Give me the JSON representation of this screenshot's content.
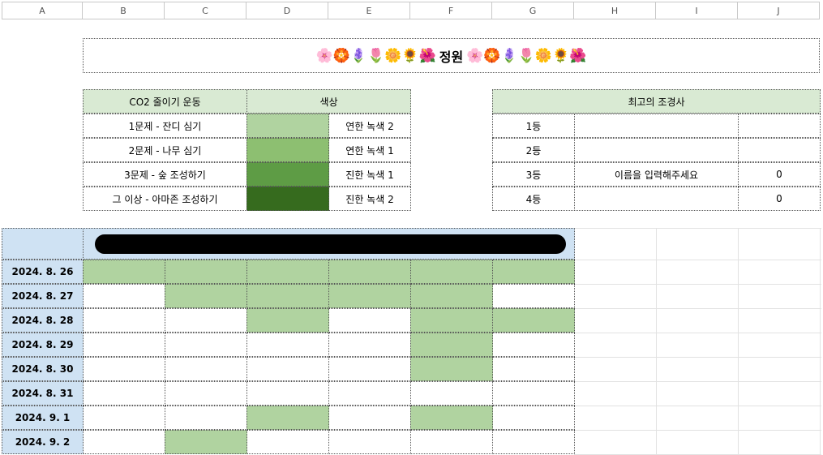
{
  "columns": [
    "A",
    "B",
    "C",
    "D",
    "E",
    "F",
    "G",
    "H",
    "I",
    "J"
  ],
  "title": {
    "emoji_left": "🌸🏵️🪻🌷🌼🌻🌺",
    "text": "정원",
    "emoji_right": "🌸🏵️🪻🌷🌼🌻🌺"
  },
  "legend": {
    "header_activity": "CO2 줄이기 운동",
    "header_color": "색상",
    "rows": [
      {
        "activity": "1문제 - 잔디 심기",
        "swatch": "#b0d3a0",
        "color_name": "연한 녹색 2"
      },
      {
        "activity": "2문제 - 나무 심기",
        "swatch": "#8dbf71",
        "color_name": "연한 녹색 1"
      },
      {
        "activity": "3문제 - 숲 조성하기",
        "swatch": "#5e9c45",
        "color_name": "진한 녹색 1"
      },
      {
        "activity": "그 이상 - 아마존 조성하기",
        "swatch": "#366b1e",
        "color_name": "진한 녹색 2"
      }
    ]
  },
  "ranking": {
    "header": "최고의 조경사",
    "rows": [
      {
        "rank": "1등",
        "name": "",
        "score": ""
      },
      {
        "rank": "2등",
        "name": "",
        "score": ""
      },
      {
        "rank": "3등",
        "name": "이름을 입력해주세요",
        "score": "0"
      },
      {
        "rank": "4등",
        "name": "",
        "score": "0"
      }
    ]
  },
  "grid": {
    "mark_color": "#b0d3a0",
    "rows": [
      {
        "date": "2024. 8. 26",
        "cells": [
          1,
          1,
          1,
          1,
          1,
          1
        ]
      },
      {
        "date": "2024. 8. 27",
        "cells": [
          0,
          1,
          1,
          1,
          1,
          0
        ]
      },
      {
        "date": "2024. 8. 28",
        "cells": [
          0,
          0,
          1,
          0,
          1,
          1
        ]
      },
      {
        "date": "2024. 8. 29",
        "cells": [
          0,
          0,
          0,
          0,
          1,
          0
        ]
      },
      {
        "date": "2024. 8. 30",
        "cells": [
          0,
          0,
          0,
          0,
          1,
          0
        ]
      },
      {
        "date": "2024. 8. 31",
        "cells": [
          0,
          0,
          0,
          0,
          0,
          0
        ]
      },
      {
        "date": "2024. 9. 1",
        "cells": [
          0,
          0,
          1,
          0,
          1,
          0
        ]
      },
      {
        "date": "2024. 9. 2",
        "cells": [
          0,
          1,
          0,
          0,
          0,
          0
        ]
      }
    ]
  },
  "colors": {
    "header_green": "#d9ead3",
    "date_blue": "#cfe2f3"
  }
}
